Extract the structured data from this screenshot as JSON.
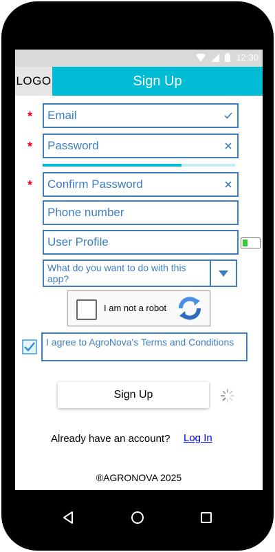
{
  "status_bar": {
    "time": "12:30"
  },
  "header": {
    "logo": "LOGO",
    "title": "Sign Up"
  },
  "form": {
    "email": {
      "placeholder": "Email",
      "status_icon": "check-icon",
      "required": "*"
    },
    "password": {
      "placeholder": "Password",
      "status_icon": "clear-icon",
      "required": "*"
    },
    "password_strength": 0.72,
    "confirm_password": {
      "placeholder": "Confirm Password",
      "status_icon": "clear-icon",
      "required": "*"
    },
    "phone": {
      "placeholder": "Phone number"
    },
    "user_profile": {
      "placeholder": "User Profile",
      "toggle_on": true
    },
    "purpose_select": {
      "placeholder": "What do you want to do with this app?"
    },
    "captcha": {
      "label": "I am not a robot"
    },
    "terms": {
      "checked": true,
      "label": "I agree to AgroNova's Terms and Conditions"
    },
    "submit_label": "Sign Up"
  },
  "login_prompt": {
    "text": "Already have an account?",
    "link": "Log In"
  },
  "footer": {
    "copyright": "®AGRONOVA 2025"
  },
  "colors": {
    "accent": "#00bcd4",
    "field_border": "#3d7ec4",
    "required": "#e0001b"
  }
}
